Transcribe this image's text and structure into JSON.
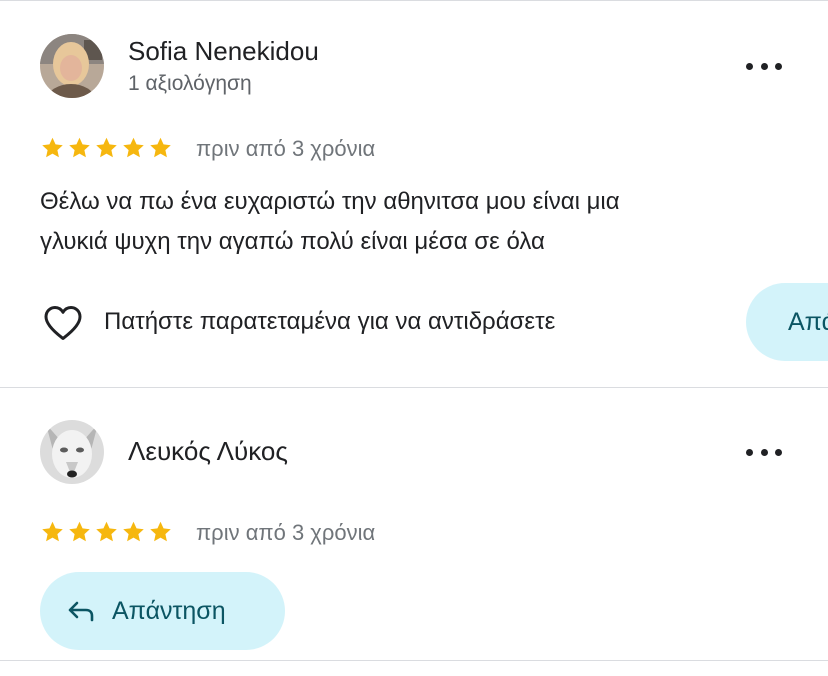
{
  "reviews": [
    {
      "author": "Sofia Nenekidou",
      "review_count": "1 αξιολόγηση",
      "rating": 5,
      "date": "πριν από 3 χρόνια",
      "text_lines": [
        "Θέλω να πω ένα ευχαριστώ την αθηνιτσα μου είναι μια",
        "γλυκιά ψυχη την αγαπώ πολύ είναι μέσα σε όλα"
      ],
      "react_hint": "Πατήστε παρατεταμένα για να αντιδράσετε",
      "reply_label": "Απάντηση"
    },
    {
      "author": "Λευκός Λύκος",
      "rating": 5,
      "date": "πριν από 3 χρόνια",
      "reply_label": "Απάντηση"
    }
  ],
  "colors": {
    "star": "#f6b70f",
    "reply_bg": "#d3f3fa",
    "reply_text": "#0b5563",
    "divider": "#dadce0"
  },
  "icons": {
    "more": "more-options-icon",
    "heart": "heart-outline-icon",
    "reply": "reply-arrow-icon",
    "star": "star-icon"
  }
}
